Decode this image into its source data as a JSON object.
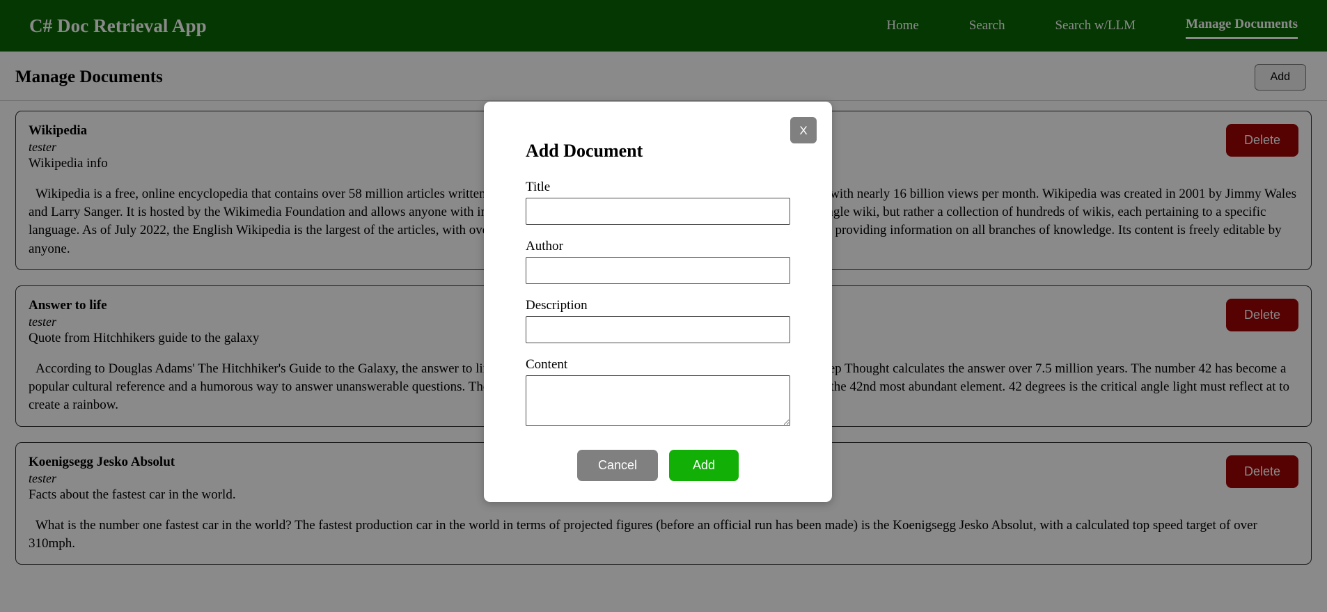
{
  "navbar": {
    "brand": "C# Doc Retrieval App",
    "links": [
      {
        "label": "Home",
        "active": false
      },
      {
        "label": "Search",
        "active": false
      },
      {
        "label": "Search w/LLM",
        "active": false
      },
      {
        "label": "Manage Documents",
        "active": true
      }
    ]
  },
  "page": {
    "title": "Manage Documents",
    "add_button_label": "Add"
  },
  "documents": [
    {
      "title": "Wikipedia",
      "author": "tester",
      "description": "Wikipedia info",
      "content": "Wikipedia is a free, online encyclopedia that contains over 58 million articles written in 326 languages. It is the largest collection of open knowledge, with nearly 16 billion views per month. Wikipedia was created in 2001 by Jimmy Wales and Larry Sanger. It is hosted by the Wikimedia Foundation and allows anyone with internet access to create and develop articles. Wikipedia is not a single wiki, but rather a collection of hundreds of wikis, each pertaining to a specific language. As of July 2022, the English Wikipedia is the largest of the articles, with over six million articles. Wikipedia's purpose is to benefit readers by providing information on all branches of knowledge. Its content is freely editable by anyone.",
      "delete_label": "Delete"
    },
    {
      "title": "Answer to life",
      "author": "tester",
      "description": "Quote from Hitchhikers guide to the galaxy",
      "content": "According to Douglas Adams' The Hitchhiker's Guide to the Galaxy, the answer to life, the universe and everything is 42. A supercomputer named Deep Thought calculates the answer over 7.5 million years. The number 42 has become a popular cultural reference and a humorous way to answer unanswerable questions. The number 42 is also the atomic number of molybdenum, which is the 42nd most abundant element. 42 degrees is the critical angle light must reflect at to create a rainbow.",
      "delete_label": "Delete"
    },
    {
      "title": "Koenigsegg Jesko Absolut",
      "author": "tester",
      "description": "Facts about the fastest car in the world.",
      "content": "What is the number one fastest car in the world? The fastest production car in the world in terms of projected figures (before an official run has been made) is the Koenigsegg Jesko Absolut, with a calculated top speed target of over 310mph.",
      "delete_label": "Delete"
    }
  ],
  "modal": {
    "title": "Add Document",
    "close_label": "X",
    "fields": [
      {
        "label": "Title",
        "value": "",
        "placeholder": ""
      },
      {
        "label": "Author",
        "value": "",
        "placeholder": ""
      },
      {
        "label": "Description",
        "value": "",
        "placeholder": ""
      },
      {
        "label": "Content",
        "value": "",
        "placeholder": ""
      }
    ],
    "cancel_label": "Cancel",
    "submit_label": "Add"
  },
  "colors": {
    "navbar_green": "#0a6605",
    "delete_red": "#a00404",
    "add_green": "#12af06",
    "cancel_gray": "#808080",
    "backdrop": "rgba(0,0,0,0.46)"
  }
}
